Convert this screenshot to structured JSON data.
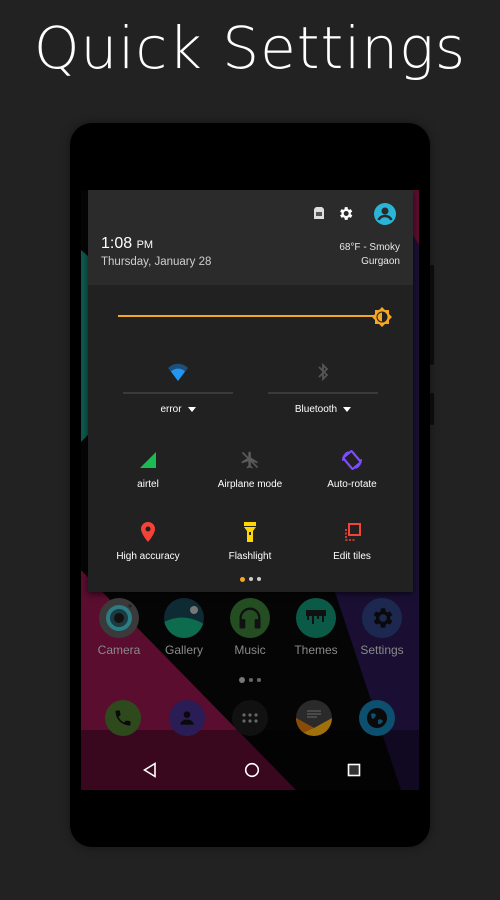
{
  "promo": {
    "title": "Quick Settings"
  },
  "status_header": {
    "time": "1:08",
    "ampm": "PM",
    "date": "Thursday, January 28",
    "weather": "68°F - Smoky",
    "location": "Gurgaon",
    "icons": [
      "sim-card-icon",
      "settings-gear-icon",
      "user-account-icon"
    ],
    "accent_color": "#29b6d6"
  },
  "brightness": {
    "level_percent": 100,
    "color": "#f5a623"
  },
  "big_tiles": [
    {
      "id": "wifi",
      "icon": "wifi-icon",
      "label": "error",
      "color": "#2196f3",
      "has_dropdown": true
    },
    {
      "id": "bluetooth",
      "icon": "bluetooth-icon",
      "label": "Bluetooth",
      "color": "#555555",
      "has_dropdown": true
    }
  ],
  "tiles": [
    {
      "id": "cellular",
      "icon": "cell-signal-icon",
      "label": "airtel",
      "color": "#1db954"
    },
    {
      "id": "airplane",
      "icon": "airplane-icon",
      "label": "Airplane mode",
      "color": "#5a5a5a"
    },
    {
      "id": "rotate",
      "icon": "auto-rotate-icon",
      "label": "Auto-rotate",
      "color": "#7c4dff"
    },
    {
      "id": "location",
      "icon": "location-pin-icon",
      "label": "High accuracy",
      "color": "#f44336"
    },
    {
      "id": "flashlight",
      "icon": "flashlight-icon",
      "label": "Flashlight",
      "color": "#ffd600"
    },
    {
      "id": "edit",
      "icon": "edit-tiles-icon",
      "label": "Edit tiles",
      "color": "#f44336"
    }
  ],
  "qs_pages": {
    "count": 3,
    "active": 0
  },
  "home_apps": [
    {
      "icon": "camera-icon",
      "label": "Camera"
    },
    {
      "icon": "gallery-icon",
      "label": "Gallery"
    },
    {
      "icon": "headphones-icon",
      "label": "Music"
    },
    {
      "icon": "themes-icon",
      "label": "Themes"
    },
    {
      "icon": "settings-icon",
      "label": "Settings"
    }
  ],
  "home_pages": {
    "count": 3,
    "active": 0
  },
  "dock": [
    "phone-icon",
    "contacts-icon",
    "app-drawer-icon",
    "messaging-icon",
    "browser-icon"
  ],
  "navbar": [
    "back-icon",
    "home-icon",
    "recents-icon"
  ]
}
